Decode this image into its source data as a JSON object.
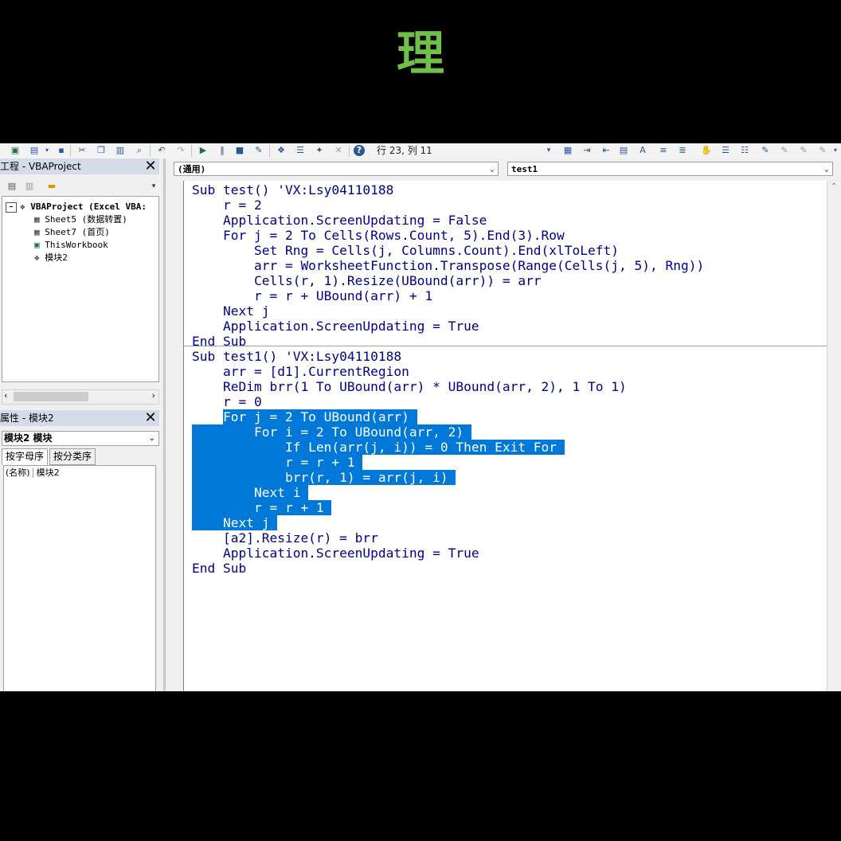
{
  "caption": "理",
  "toolbar": {
    "status": "行 23, 列 11",
    "icons": [
      "excel-icon",
      "insert-userform-icon",
      "save-icon",
      "cut-icon",
      "copy-icon",
      "paste-icon",
      "find-icon",
      "undo-icon",
      "redo-icon",
      "run-icon",
      "break-icon",
      "reset-icon",
      "design-mode-icon",
      "project-explorer-icon",
      "properties-icon",
      "object-browser-icon",
      "toolbox-icon",
      "help-icon"
    ]
  },
  "project_panel": {
    "title": "工程 - VBAProject",
    "items": [
      {
        "label": "VBAProject (Excel VBA:"
      },
      {
        "label": "Sheet5 (数据转置)"
      },
      {
        "label": "Sheet7 (首页)"
      },
      {
        "label": "ThisWorkbook"
      },
      {
        "label": "模块2"
      }
    ]
  },
  "properties_panel": {
    "title": "属性 - 模块2",
    "object_select": "模块2 模块",
    "tabs": [
      "按字母序",
      "按分类序"
    ],
    "row_name": "(名称)",
    "row_value": "模块2"
  },
  "editor": {
    "object_combo": "(通用)",
    "procedure_combo": "test1",
    "lines": [
      {
        "text": "Sub test() 'VX:Lsy04110188",
        "sel": ""
      },
      {
        "text": "    r = 2",
        "sel": ""
      },
      {
        "text": "    Application.ScreenUpdating = False",
        "sel": ""
      },
      {
        "text": "    For j = 2 To Cells(Rows.Count, 5).End(3).Row",
        "sel": ""
      },
      {
        "text": "        Set Rng = Cells(j, Columns.Count).End(xlToLeft)",
        "sel": ""
      },
      {
        "text": "        arr = WorksheetFunction.Transpose(Range(Cells(j, 5), Rng))",
        "sel": ""
      },
      {
        "text": "        Cells(r, 1).Resize(UBound(arr)) = arr",
        "sel": ""
      },
      {
        "text": "        r = r + UBound(arr) + 1",
        "sel": ""
      },
      {
        "text": "    Next j",
        "sel": ""
      },
      {
        "text": "    Application.ScreenUpdating = True",
        "sel": ""
      },
      {
        "text": "End Sub",
        "sel": ""
      },
      {
        "text": "Sub test1() 'VX:Lsy04110188",
        "sel": ""
      },
      {
        "text": "    arr = [d1].CurrentRegion",
        "sel": ""
      },
      {
        "text": "    ReDim brr(1 To UBound(arr) * UBound(arr, 2), 1 To 1)",
        "sel": ""
      },
      {
        "text": "    r = 0",
        "sel": ""
      },
      {
        "text": "    For j = 2 To UBound(arr)",
        "sel": "tail"
      },
      {
        "text": "        For i = 2 To UBound(arr, 2)",
        "sel": "full"
      },
      {
        "text": "            If Len(arr(j, i)) = 0 Then Exit For",
        "sel": "full"
      },
      {
        "text": "            r = r + 1",
        "sel": "full"
      },
      {
        "text": "            brr(r, 1) = arr(j, i)",
        "sel": "full"
      },
      {
        "text": "        Next i",
        "sel": "full"
      },
      {
        "text": "        r = r + 1",
        "sel": "full"
      },
      {
        "text": "    Next j",
        "sel": "full"
      },
      {
        "text": "    [a2].Resize(r) = brr",
        "sel": ""
      },
      {
        "text": "    Application.ScreenUpdating = True",
        "sel": ""
      },
      {
        "text": "End Sub",
        "sel": ""
      }
    ]
  },
  "colors": {
    "keyword": "#00008b",
    "selection": "#0078d7",
    "caption": "#6fbf4a"
  }
}
